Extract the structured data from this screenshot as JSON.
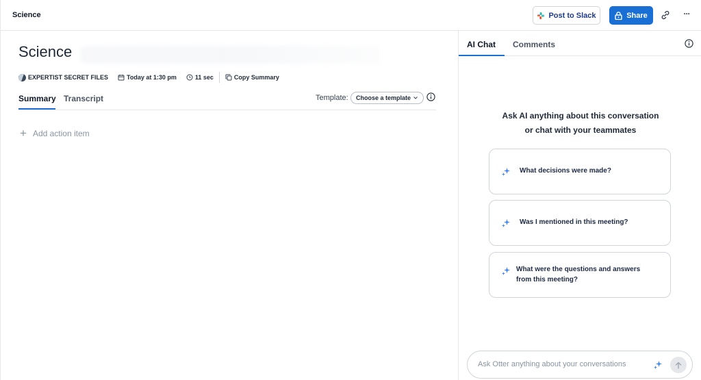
{
  "header": {
    "title": "Science",
    "post_to_slack": "Post to Slack",
    "share": "Share",
    "icons": [
      "slack-icon",
      "lock-icon",
      "link-icon",
      "more-icon"
    ]
  },
  "conversation": {
    "title": "Science",
    "meta": {
      "folder": "EXPERTIST SECRET FILES",
      "date": "Today at 1:30 pm",
      "duration": "11 sec",
      "copy": "Copy Summary"
    },
    "tabs": [
      "Summary",
      "Transcript"
    ],
    "active_tab": "Summary",
    "template_label": "Template:",
    "template_select": "Choose a template",
    "add_action": "Add action item"
  },
  "chat": {
    "tabs": [
      "AI Chat",
      "Comments"
    ],
    "active_tab": "AI Chat",
    "prompt_line1": "Ask AI anything about this conversation",
    "prompt_line2": "or chat with your teammates",
    "suggestions": [
      "What decisions were made?",
      "Was I mentioned in this meeting?",
      "What were the questions and answers from this meeting?"
    ],
    "input_placeholder": "Ask Otter anything about your conversations"
  },
  "colors": {
    "accent": "#1a6fd4",
    "sparkle": "#3b82f6",
    "border": "#e5e7eb"
  }
}
